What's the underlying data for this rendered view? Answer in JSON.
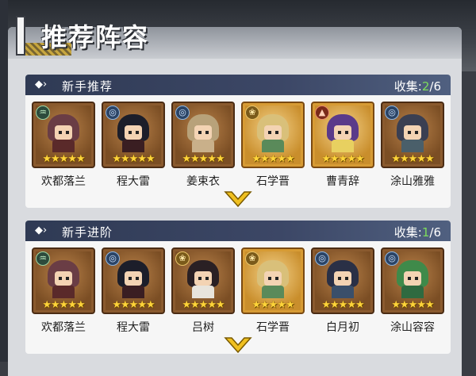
{
  "page": {
    "title": "推荐阵容"
  },
  "sections": [
    {
      "title": "新手推荐",
      "collect_label": "收集:",
      "collect_count": "2",
      "collect_total": "/6",
      "heroes": [
        {
          "name": "欢都落兰",
          "badge_icon": "wind-icon",
          "badge_glyph": "♒",
          "frame": "bronze",
          "stars": "★★★★★"
        },
        {
          "name": "程大雷",
          "badge_icon": "water-icon",
          "badge_glyph": "◎",
          "frame": "bronze",
          "stars": "★★★★★"
        },
        {
          "name": "姜束衣",
          "badge_icon": "water-icon",
          "badge_glyph": "◎",
          "frame": "bronze",
          "stars": "★★★★★"
        },
        {
          "name": "石学晋",
          "badge_icon": "lotus-icon",
          "badge_glyph": "❀",
          "frame": "gold",
          "stars": "★★★★★"
        },
        {
          "name": "曹青辞",
          "badge_icon": "fire-icon",
          "badge_glyph": "▲",
          "frame": "gold",
          "stars": "★★★★★"
        },
        {
          "name": "涂山雅雅",
          "badge_icon": "water-icon",
          "badge_glyph": "◎",
          "frame": "bronze",
          "stars": "★★★★★"
        }
      ]
    },
    {
      "title": "新手进阶",
      "collect_label": "收集:",
      "collect_count": "1",
      "collect_total": "/6",
      "heroes": [
        {
          "name": "欢都落兰",
          "badge_icon": "wind-icon",
          "badge_glyph": "♒",
          "frame": "bronze",
          "stars": "★★★★★"
        },
        {
          "name": "程大雷",
          "badge_icon": "water-icon",
          "badge_glyph": "◎",
          "frame": "bronze",
          "stars": "★★★★★"
        },
        {
          "name": "吕树",
          "badge_icon": "lotus-icon",
          "badge_glyph": "❀",
          "frame": "bronze",
          "stars": "★★★★★"
        },
        {
          "name": "石学晋",
          "badge_icon": "lotus-icon",
          "badge_glyph": "❀",
          "frame": "gold",
          "stars": "★★★★★"
        },
        {
          "name": "白月初",
          "badge_icon": "water-icon",
          "badge_glyph": "◎",
          "frame": "bronze",
          "stars": "★★★★★"
        },
        {
          "name": "涂山容容",
          "badge_icon": "water-icon",
          "badge_glyph": "◎",
          "frame": "bronze",
          "stars": "★★★★★"
        }
      ]
    }
  ],
  "colors": {
    "collect_highlight": "#7ddc5c",
    "chevron": "#f0c020",
    "header_dark": "#2f3a54"
  }
}
